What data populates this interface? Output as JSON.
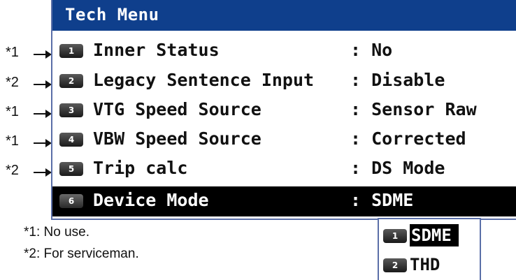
{
  "window": {
    "title": "Tech Menu"
  },
  "menu_items": [
    {
      "key": "1",
      "label": "Inner Status",
      "value": ": No",
      "footnote": "*1"
    },
    {
      "key": "2",
      "label": "Legacy Sentence Input",
      "value": ": Disable",
      "footnote": "*2"
    },
    {
      "key": "3",
      "label": "VTG Speed Source",
      "value": ": Sensor Raw",
      "footnote": "*1"
    },
    {
      "key": "4",
      "label": "VBW Speed Source",
      "value": ": Corrected",
      "footnote": "*1"
    },
    {
      "key": "5",
      "label": "Trip calc",
      "value": ": DS Mode",
      "footnote": "*2"
    },
    {
      "key": "6",
      "label": "Device Mode",
      "value": ": SDME",
      "selected": true
    }
  ],
  "notes": [
    "*1: No use.",
    "*2: For serviceman."
  ],
  "dropdown": {
    "options": [
      {
        "key": "1",
        "label": "SDME",
        "selected": true
      },
      {
        "key": "2",
        "label": "THD"
      }
    ]
  },
  "colors": {
    "title_bar": "#0f3f8c",
    "selection": "#000000",
    "frame": "#5a6fa8"
  }
}
